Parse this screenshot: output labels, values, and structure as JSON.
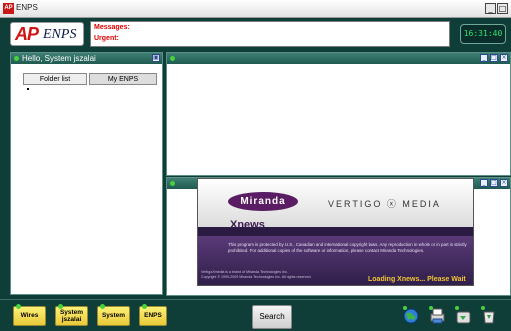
{
  "window": {
    "title": "ENPS"
  },
  "header": {
    "logo_ap": "AP",
    "logo_enps": "ENPS",
    "messages_label": "Messages:",
    "urgent_label": "Urgent:",
    "clock": "16:31:40"
  },
  "left_panel": {
    "title": "Hello, System jszalai",
    "tabs": [
      {
        "label": "Folder list"
      },
      {
        "label": "My ENPS"
      }
    ]
  },
  "splash": {
    "brand_logo": "Miranda",
    "brand_right": "VERTIGO ⓧ MEDIA",
    "product": "Xnews",
    "legal": "This program is protected by U.S., Canadian and international copyright laws. Any reproduction in whole or in part is strictly prohibited. For additional copies of the software or information, please contact Miranda Technologies.",
    "trademark": "VertigoXmedia is a brand of Miranda Technologies Inc.",
    "copyright": "Copyright © 1999-2009 Miranda Technologies Inc. All rights reserved.",
    "loading": "Loading Xnews... Please Wait"
  },
  "bottom_bar": {
    "folders": [
      {
        "label": "Wires"
      },
      {
        "label": "System jszalai"
      },
      {
        "label": "System"
      },
      {
        "label": "ENPS"
      }
    ],
    "search_label": "Search",
    "tray_icons": [
      "globe-icon",
      "printer-icon",
      "drive-icon",
      "recycle-icon"
    ]
  },
  "colors": {
    "background": "#0f3d37",
    "panel_header": "#2a6b60",
    "clock_text": "#34e070",
    "alert_text": "#e00000",
    "loading_text": "#f2c530",
    "folder_yellow": "#f4da4e"
  }
}
